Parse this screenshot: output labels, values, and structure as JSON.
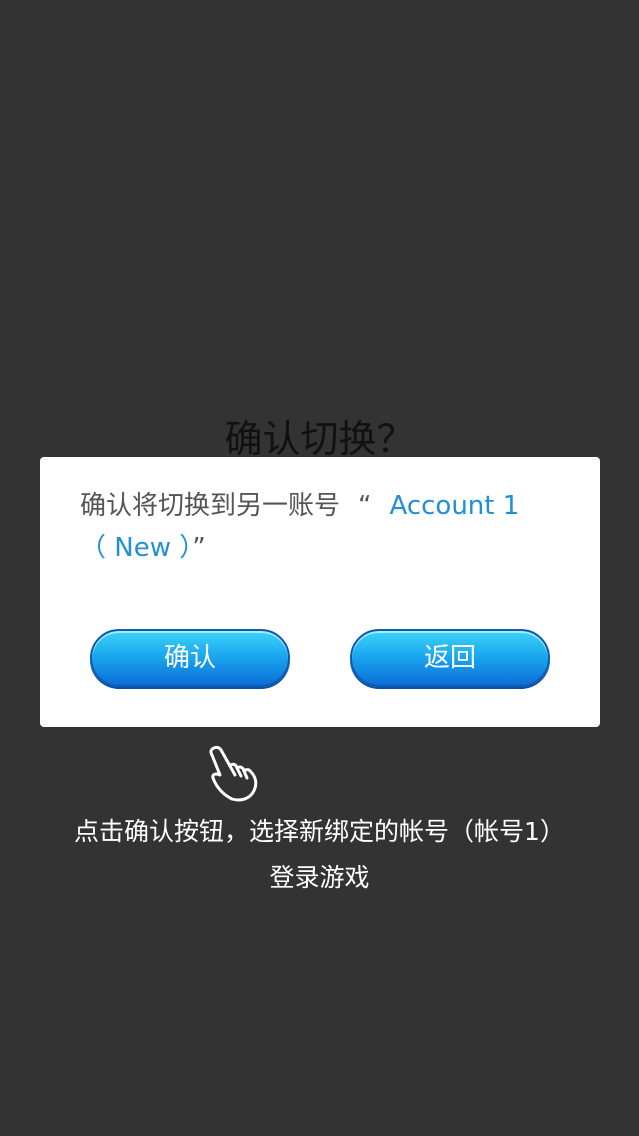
{
  "background_title": "确认切换？",
  "dialog": {
    "message_prefix": "确认将切换到另一账号",
    "open_quote": "“",
    "account_name": "Account 1",
    "account_suffix": "（ New ）",
    "close_quote": "”",
    "confirm_label": "确认",
    "back_label": "返回"
  },
  "hint": {
    "icon": "pointing-hand-icon",
    "line1": "点击确认按钮，选择新绑定的帐号（帐号1）",
    "line2": "登录游戏"
  },
  "colors": {
    "overlay": "#333333",
    "accent_text": "#1f8fd9",
    "button_top": "#3ed4f8",
    "button_bottom": "#0d6ed7"
  }
}
